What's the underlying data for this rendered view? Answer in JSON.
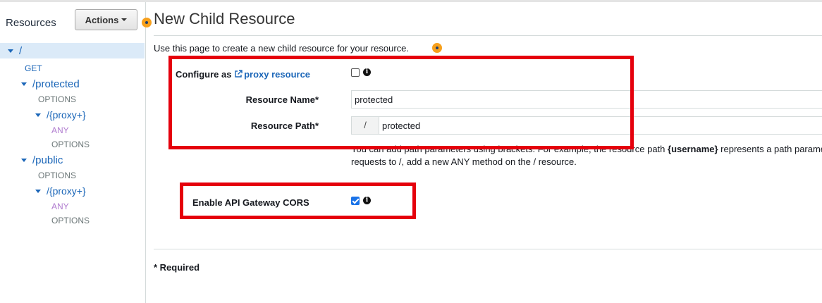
{
  "sidebar": {
    "title": "Resources",
    "actions_label": "Actions",
    "tree": [
      {
        "label": "/",
        "kind": "path",
        "selected": true
      },
      {
        "label": "GET",
        "kind": "method-get"
      },
      {
        "label": "/protected",
        "kind": "path"
      },
      {
        "label": "OPTIONS",
        "kind": "method"
      },
      {
        "label": "/{proxy+}",
        "kind": "path"
      },
      {
        "label": "ANY",
        "kind": "method-any"
      },
      {
        "label": "OPTIONS",
        "kind": "method"
      },
      {
        "label": "/public",
        "kind": "path"
      },
      {
        "label": "OPTIONS",
        "kind": "method"
      },
      {
        "label": "/{proxy+}",
        "kind": "path"
      },
      {
        "label": "ANY",
        "kind": "method-any"
      },
      {
        "label": "OPTIONS",
        "kind": "method"
      }
    ]
  },
  "main": {
    "title": "New Child Resource",
    "intro": "Use this page to create a new child resource for your resource.",
    "configure_label": "Configure as",
    "proxy_link": "proxy resource",
    "proxy_checked": false,
    "resource_name_label": "Resource Name*",
    "resource_name_value": "protected",
    "resource_path_label": "Resource Path*",
    "resource_path_prefix": "/",
    "resource_path_value": "protected",
    "help_line1_pre": "You can add path parameters using brackets. For example, the resource path ",
    "help_line1_bold": "{username}",
    "help_line1_post": " represents a path parameter called 'username'. Configuring /{proxy+} as a proxy resource catches all",
    "help_line2": "requests to /, add a new ANY method on the / resource.",
    "cors_label": "Enable API Gateway CORS",
    "cors_checked": true,
    "required_note": "* Required"
  },
  "colors": {
    "link": "#1b66b8",
    "any_method": "#b07ccf",
    "highlight_box": "#e5000c",
    "selected_row": "#dbeaf8",
    "checkbox_checked": "#1a73e8"
  }
}
